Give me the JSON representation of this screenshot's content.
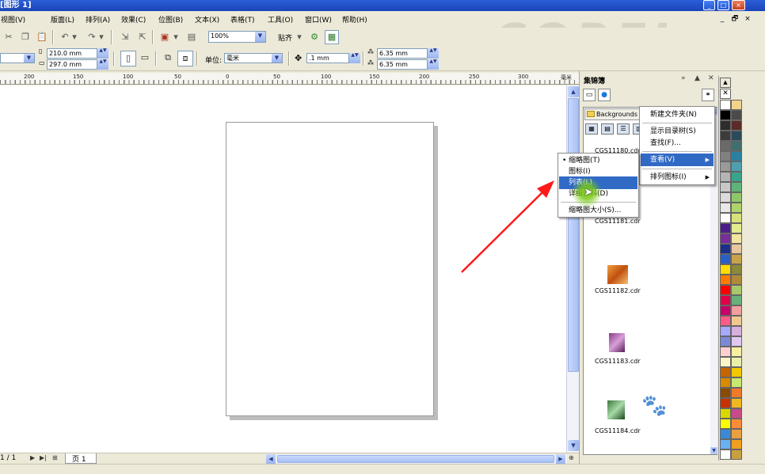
{
  "window": {
    "title": "[图形 1]",
    "controls": [
      "_",
      "□",
      "×"
    ]
  },
  "menubar": {
    "items": [
      "视图(V)",
      "版面(L)",
      "排列(A)",
      "效果(C)",
      "位图(B)",
      "文本(X)",
      "表格(T)",
      "工具(O)",
      "窗口(W)",
      "帮助(H)"
    ],
    "mdi_controls": [
      "_",
      "🗗",
      "×"
    ]
  },
  "toolbar": {
    "zoom_level": "100%",
    "snap_label": "贴齐"
  },
  "property_bar": {
    "page_width": "210.0 mm",
    "page_height": "297.0 mm",
    "units_label": "单位:",
    "units_value": "毫米",
    "nudge_value": ".1 mm",
    "duplicate_x": "6.35 mm",
    "duplicate_y": "6.35 mm"
  },
  "brand": {
    "logo_text": "COREL"
  },
  "ruler": {
    "labels": [
      "200",
      "150",
      "100",
      "50",
      "0",
      "50",
      "100",
      "150",
      "200",
      "250",
      "300",
      "毫米"
    ]
  },
  "status": {
    "page_count": "1 / 1",
    "page_tab": "页 1"
  },
  "docker": {
    "title": "集锦簿",
    "folder": "Backgrounds",
    "files": [
      "CGS11180.cdr",
      "CGS11181.cdr",
      "CGS11182.cdr",
      "CGS11183.cdr",
      "CGS11184.cdr"
    ]
  },
  "context_menu": {
    "items": [
      "新建文件夹(N)",
      "显示目录树(S)",
      "查找(F)...",
      "查看(V)",
      "排列图标(I)"
    ],
    "highlighted": "查看(V)"
  },
  "view_submenu": {
    "items": [
      "缩略图(T)",
      "图标(I)",
      "列表(L)",
      "详细资料(D)",
      "缩略图大小(S)..."
    ],
    "checked": "缩略图(T)",
    "highlighted": "列表(L)"
  },
  "colors": {
    "title_bar": "#1b44b8",
    "highlight": "#316ac5",
    "arrow": "#ff1a1a",
    "palette": [
      "#ffffff",
      "#f2d38a",
      "#000000",
      "#4a4a4a",
      "#2d2d2d",
      "#5a2b28",
      "#3c3c3c",
      "#2a4a5a",
      "#6a6a6a",
      "#3f6f6f",
      "#808080",
      "#2b7fa0",
      "#9a9a9a",
      "#4ea0b0",
      "#b4b4b4",
      "#3aa38b",
      "#c8c8c8",
      "#5fb47a",
      "#dcdcdc",
      "#8ec86b",
      "#e8e8e8",
      "#b0d36b",
      "#ffffff",
      "#d8e27a",
      "#4b1f8a",
      "#e3ec8e",
      "#7a2c9a",
      "#f2e6a0",
      "#1d2f8a",
      "#e8c6a0",
      "#2a5fc8",
      "#c9a34a",
      "#ffdd00",
      "#8a8a3a",
      "#ff7a00",
      "#b08a3a",
      "#ff0000",
      "#a8c86a",
      "#e0004a",
      "#6ab07a",
      "#c8006a",
      "#f0a0a0",
      "#ff5a8a",
      "#f0c890",
      "#a8a8ff",
      "#d8b0e0",
      "#7a8ad8",
      "#e0c8f0",
      "#ffd0d0",
      "#f8f0a0",
      "#fff4c8",
      "#e8f0a8",
      "#c86400",
      "#f2c800",
      "#d88a00",
      "#c8e870",
      "#8a4a00",
      "#f07a2a",
      "#c83200",
      "#f0b820",
      "#d8d800",
      "#c84a8a",
      "#ffff00",
      "#ff8a3a",
      "#3a8ad8",
      "#e8a040",
      "#6ab0f0",
      "#f0a020",
      "#ffffff",
      "#c8a040"
    ]
  }
}
